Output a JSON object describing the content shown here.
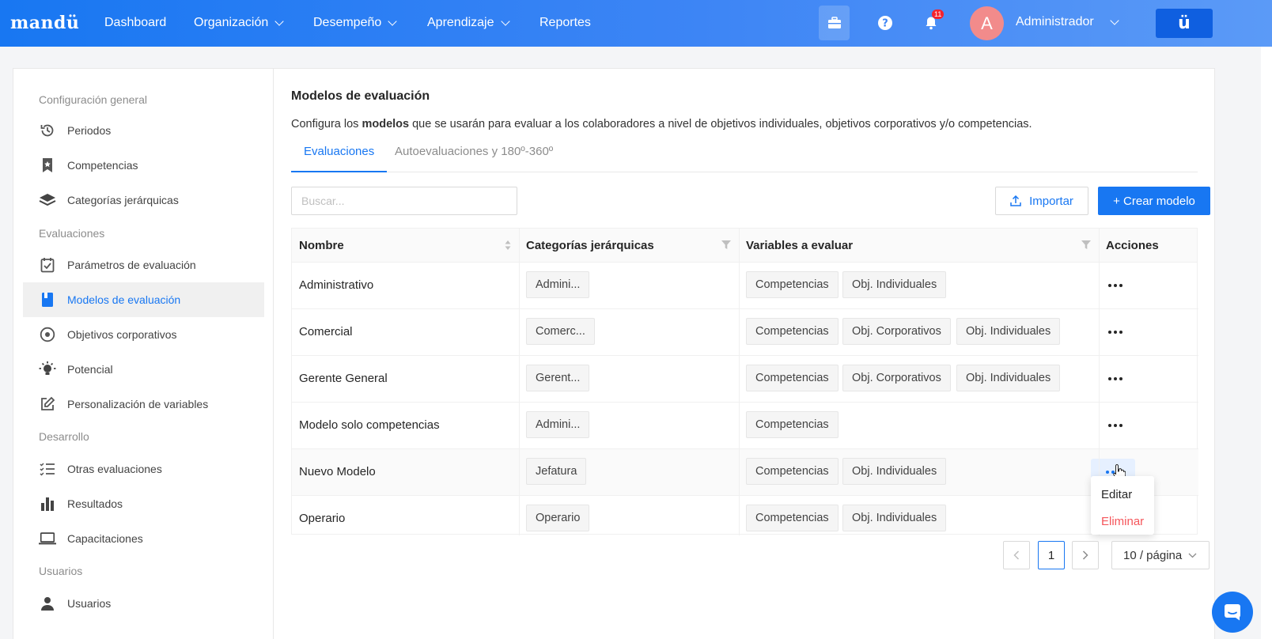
{
  "nav": {
    "logo": "mandü",
    "items": [
      {
        "label": "Dashboard",
        "dropdown": false
      },
      {
        "label": "Organización",
        "dropdown": true
      },
      {
        "label": "Desempeño",
        "dropdown": true
      },
      {
        "label": "Aprendizaje",
        "dropdown": true
      },
      {
        "label": "Reportes",
        "dropdown": false
      }
    ],
    "notifications_count": "11",
    "avatar_initial": "A",
    "user_name": "Administrador",
    "brand_button": "ü"
  },
  "sidebar": {
    "sections": [
      {
        "title": "Configuración general",
        "items": [
          {
            "label": "Periodos",
            "icon": "history-icon"
          },
          {
            "label": "Competencias",
            "icon": "bookmark-icon"
          },
          {
            "label": "Categorías jerárquicas",
            "icon": "layers-icon"
          }
        ]
      },
      {
        "title": "Evaluaciones",
        "items": [
          {
            "label": "Parámetros de evaluación",
            "icon": "checklist-icon"
          },
          {
            "label": "Modelos de evaluación",
            "icon": "book-icon",
            "active": true
          },
          {
            "label": "Objetivos corporativos",
            "icon": "target-icon"
          },
          {
            "label": "Potencial",
            "icon": "bulb-icon"
          },
          {
            "label": "Personalización de variables",
            "icon": "edit-icon"
          }
        ]
      },
      {
        "title": "Desarrollo",
        "items": [
          {
            "label": "Otras evaluaciones",
            "icon": "list-icon"
          },
          {
            "label": "Resultados",
            "icon": "bar-chart-icon"
          },
          {
            "label": "Capacitaciones",
            "icon": "laptop-icon"
          }
        ]
      },
      {
        "title": "Usuarios",
        "items": [
          {
            "label": "Usuarios",
            "icon": "user-icon"
          }
        ]
      }
    ]
  },
  "main": {
    "title": "Modelos de evaluación",
    "desc_pre": "Configura los ",
    "desc_bold": "modelos",
    "desc_post": " que se usarán para evaluar a los colaboradores a nivel de objetivos individuales, objetivos corporativos y/o competencias.",
    "tabs": [
      {
        "label": "Evaluaciones",
        "active": true
      },
      {
        "label": "Autoevaluaciones y 180º-360º",
        "active": false
      }
    ],
    "search_placeholder": "Buscar...",
    "import_label": "Importar",
    "create_label": "+ Crear modelo",
    "columns": [
      "Nombre",
      "Categorías jerárquicas",
      "Variables a evaluar",
      "Acciones"
    ],
    "rows": [
      {
        "name": "Administrativo",
        "category": "Admini...",
        "variables": [
          "Competencias",
          "Obj. Individuales"
        ]
      },
      {
        "name": "Comercial",
        "category": "Comerc...",
        "variables": [
          "Competencias",
          "Obj. Corporativos",
          "Obj. Individuales"
        ]
      },
      {
        "name": "Gerente General",
        "category": "Gerent...",
        "variables": [
          "Competencias",
          "Obj. Corporativos",
          "Obj. Individuales"
        ]
      },
      {
        "name": "Modelo solo competencias",
        "category": "Admini...",
        "variables": [
          "Competencias"
        ]
      },
      {
        "name": "Nuevo Modelo",
        "category": "Jefatura",
        "variables": [
          "Competencias",
          "Obj. Individuales"
        ]
      },
      {
        "name": "Operario",
        "category": "Operario",
        "variables": [
          "Competencias",
          "Obj. Individuales"
        ]
      }
    ],
    "actions_menu": {
      "edit": "Editar",
      "delete": "Eliminar"
    },
    "pagination": {
      "prev": "<",
      "current": "1",
      "next": ">",
      "page_size": "10 / página"
    }
  },
  "colors": {
    "primary": "#1877f2",
    "danger": "#f5565b"
  }
}
